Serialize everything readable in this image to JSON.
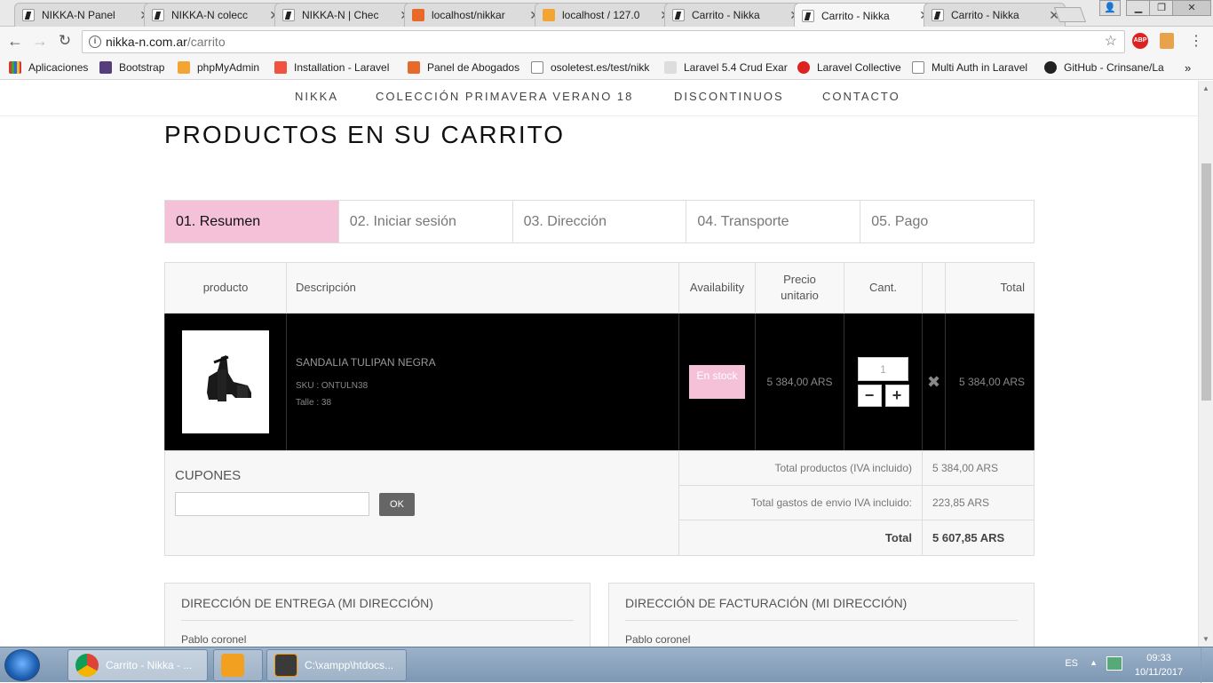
{
  "browser": {
    "tabs": [
      {
        "title": "NIKKA-N Panel",
        "icon": "nikka-favicon"
      },
      {
        "title": "NIKKA-N colecc",
        "icon": "nikka-favicon"
      },
      {
        "title": "NIKKA-N | Chec",
        "icon": "nikka-favicon"
      },
      {
        "title": "localhost/nikkar",
        "icon": "xampp-favicon"
      },
      {
        "title": "localhost / 127.0",
        "icon": "phpmyadmin-favicon"
      },
      {
        "title": "Carrito - Nikka",
        "icon": "nikka-favicon"
      },
      {
        "title": "Carrito - Nikka",
        "icon": "nikka-favicon",
        "active": true
      },
      {
        "title": "Carrito - Nikka",
        "icon": "nikka-favicon"
      }
    ],
    "url_host": "nikka-n.com.ar",
    "url_path": "/carrito",
    "extension_label": "ABP",
    "bookmarks": [
      {
        "label": "Aplicaciones",
        "icon": "apps-grid-icon"
      },
      {
        "label": "Bootstrap",
        "icon": "bootstrap-icon"
      },
      {
        "label": "phpMyAdmin",
        "icon": "phpmyadmin-icon"
      },
      {
        "label": "Installation - Laravel",
        "icon": "laravel-icon"
      },
      {
        "label": "Panel de Abogados",
        "icon": "xampp-icon"
      },
      {
        "label": "osoletest.es/test/nikk",
        "icon": "page-icon"
      },
      {
        "label": "Laravel 5.4 Crud Exar",
        "icon": "appdiv-icon"
      },
      {
        "label": "Laravel Collective",
        "icon": "laravel-collective-icon"
      },
      {
        "label": "Multi Auth in Laravel",
        "icon": "page-icon"
      },
      {
        "label": "GitHub - Crinsane/La",
        "icon": "github-icon"
      }
    ]
  },
  "site_nav": [
    "NIKKA",
    "COLECCIÓN PRIMAVERA VERANO 18",
    "DISCONTINUOS",
    "CONTACTO"
  ],
  "page_title": "PRODUCTOS EN SU CARRITO",
  "steps": [
    "01. Resumen",
    "02. Iniciar sesión",
    "03. Dirección",
    "04. Transporte",
    "05. Pago"
  ],
  "cart": {
    "headers": {
      "product": "producto",
      "description": "Descripción",
      "availability": "Availability",
      "unit_price": "Precio unitario",
      "qty": "Cant.",
      "total": "Total"
    },
    "item": {
      "name": "SANDALIA TULIPAN NEGRA",
      "sku": "SKU : ONTULN38",
      "size": "Talle : 38",
      "availability": "En stock",
      "unit_price": "5 384,00 ARS",
      "qty": "1",
      "total": "5 384,00 ARS"
    }
  },
  "coupons": {
    "label": "CUPONES",
    "ok": "OK",
    "value": ""
  },
  "summary": {
    "products_label": "Total productos (IVA incluido)",
    "products_value": "5 384,00 ARS",
    "shipping_label": "Total gastos de envio IVA incluido:",
    "shipping_value": "223,85 ARS",
    "total_label": "Total",
    "total_value": "5 607,85 ARS"
  },
  "delivery_address": {
    "title": "DIRECCIÓN DE ENTREGA (MI DIRECCIÓN)",
    "name": "Pablo coronel"
  },
  "billing_address": {
    "title": "DIRECCIÓN DE FACTURACIÓN (MI DIRECCIÓN)",
    "name": "Pablo coronel"
  },
  "taskbar": {
    "items": [
      {
        "label": "Carrito - Nikka - ...",
        "icon": "chrome-icon"
      },
      {
        "label": "",
        "icon": "outlook-icon"
      },
      {
        "label": "C:\\xampp\\htdocs...",
        "icon": "sublime-text-icon"
      }
    ],
    "language": "ES",
    "time": "09:33",
    "date": "10/11/2017"
  }
}
